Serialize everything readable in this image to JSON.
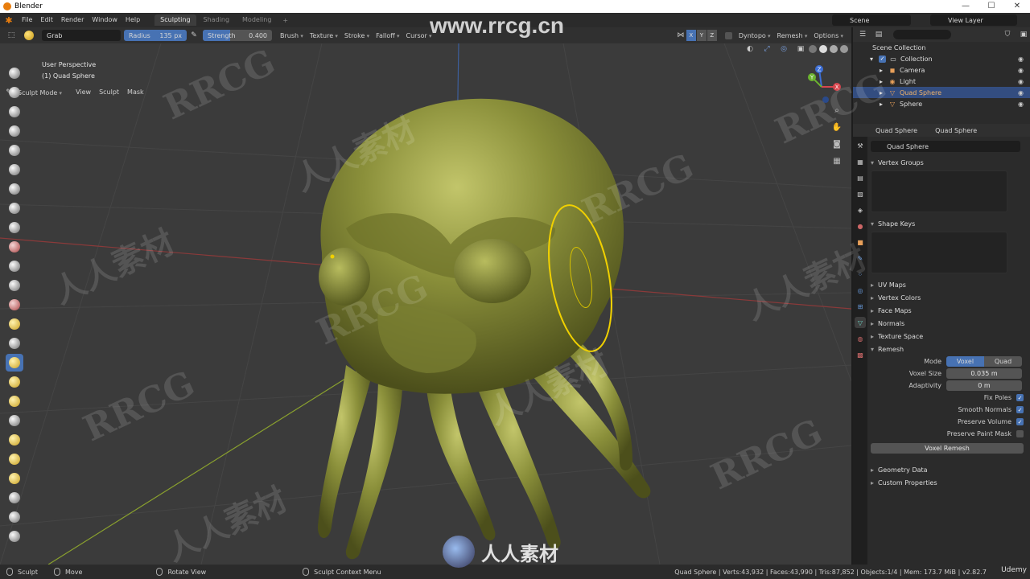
{
  "window": {
    "title": "Blender"
  },
  "menu": [
    "File",
    "Edit",
    "Render",
    "Window",
    "Help"
  ],
  "workspaces": [
    {
      "label": "Sculpting",
      "active": true
    },
    {
      "label": "Shading",
      "active": false
    },
    {
      "label": "Modeling",
      "active": false
    }
  ],
  "scene": "Scene",
  "view_layer": "View Layer",
  "tool_header": {
    "brush_name": "Grab",
    "radius_label": "Radius",
    "radius_value": "135 px",
    "strength_label": "Strength",
    "strength_value": "0.400",
    "strength_fraction": 0.4,
    "menus": [
      "Brush",
      "Texture",
      "Stroke",
      "Falloff",
      "Cursor"
    ],
    "axes": [
      "X",
      "Y",
      "Z"
    ],
    "dyntopo": "Dyntopo",
    "remesh": "Remesh",
    "options": "Options"
  },
  "mode_header": {
    "mode": "Sculpt Mode",
    "menus": [
      "View",
      "Sculpt",
      "Mask"
    ]
  },
  "viewport": {
    "perspective": "User Perspective",
    "object": "(1) Quad Sphere",
    "gizmo_axes": [
      "Z",
      "Y",
      "X"
    ]
  },
  "outliner": {
    "root": "Scene Collection",
    "collection": "Collection",
    "items": [
      {
        "label": "Camera",
        "icon": "camera-icon",
        "selected": false
      },
      {
        "label": "Light",
        "icon": "light-icon",
        "selected": false
      },
      {
        "label": "Quad Sphere",
        "icon": "mesh-icon",
        "selected": true
      },
      {
        "label": "Sphere",
        "icon": "mesh-icon",
        "selected": false
      }
    ]
  },
  "properties": {
    "header_object": "Quad Sphere",
    "header_data": "Quad Sphere",
    "mesh_name": "Quad Sphere",
    "panels": {
      "vertex_groups": "Vertex Groups",
      "shape_keys": "Shape Keys",
      "uv_maps": "UV Maps",
      "vertex_colors": "Vertex Colors",
      "face_maps": "Face Maps",
      "normals": "Normals",
      "texture_space": "Texture Space",
      "remesh": "Remesh",
      "geometry_data": "Geometry Data",
      "custom_properties": "Custom Properties"
    },
    "remesh": {
      "mode_label": "Mode",
      "mode_voxel": "Voxel",
      "mode_quad": "Quad",
      "voxel_size_label": "Voxel Size",
      "voxel_size": "0.035 m",
      "adaptivity_label": "Adaptivity",
      "adaptivity": "0 m",
      "fix_poles": "Fix Poles",
      "smooth_normals": "Smooth Normals",
      "preserve_volume": "Preserve Volume",
      "preserve_paint_mask": "Preserve Paint Mask",
      "button": "Voxel Remesh"
    }
  },
  "statusbar": {
    "left": "Sculpt",
    "move": "Move",
    "rotate": "Rotate View",
    "context": "Sculpt Context Menu",
    "stats": "Quad Sphere | Verts:43,932 | Faces:43,990 | Tris:87,852 | Objects:1/4 | Mem: 173.7 MiB | v2.82.7"
  },
  "watermarks": {
    "top": "www.rrcg.cn",
    "bottom": "人人素材",
    "tile_a": "RRCG",
    "tile_b": "人人素材",
    "corner": "Udemy"
  },
  "colors": {
    "accent": "#4772b3",
    "selection": "#334d80",
    "model": "#8a8f3a",
    "brush_cursor": "#f0d000"
  }
}
